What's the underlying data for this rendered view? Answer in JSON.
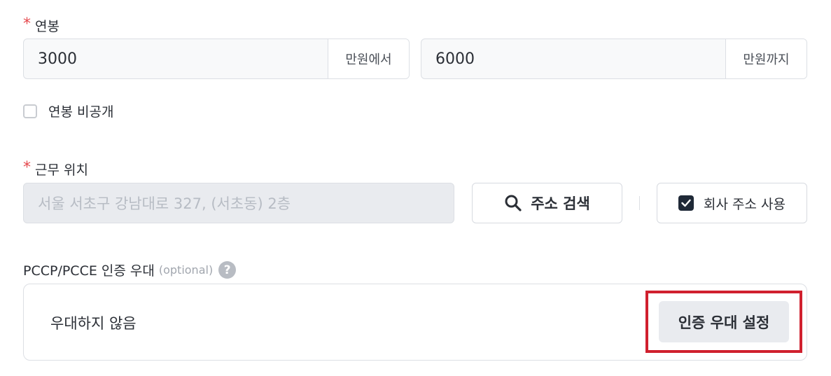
{
  "salary": {
    "label": "연봉",
    "required_mark": "*",
    "min_value": "3000",
    "min_suffix": "만원에서",
    "max_value": "6000",
    "max_suffix": "만원까지",
    "private_label": "연봉 비공개",
    "private_checked": false
  },
  "location": {
    "label": "근무 위치",
    "required_mark": "*",
    "address_placeholder": "서울 서초구 강남대로 327, (서초동) 2층",
    "search_button": "주소 검색",
    "search_icon": "search-icon",
    "company_address_label": "회사 주소 사용",
    "company_address_checked": true
  },
  "certification": {
    "label": "PCCP/PCCE 인증 우대",
    "optional": "(optional)",
    "help": "?",
    "status": "우대하지 않음",
    "button": "인증 우대 설정"
  },
  "colors": {
    "required": "#e5484d",
    "highlight": "#d0202e",
    "checkbox_checked": "#1f2937"
  }
}
